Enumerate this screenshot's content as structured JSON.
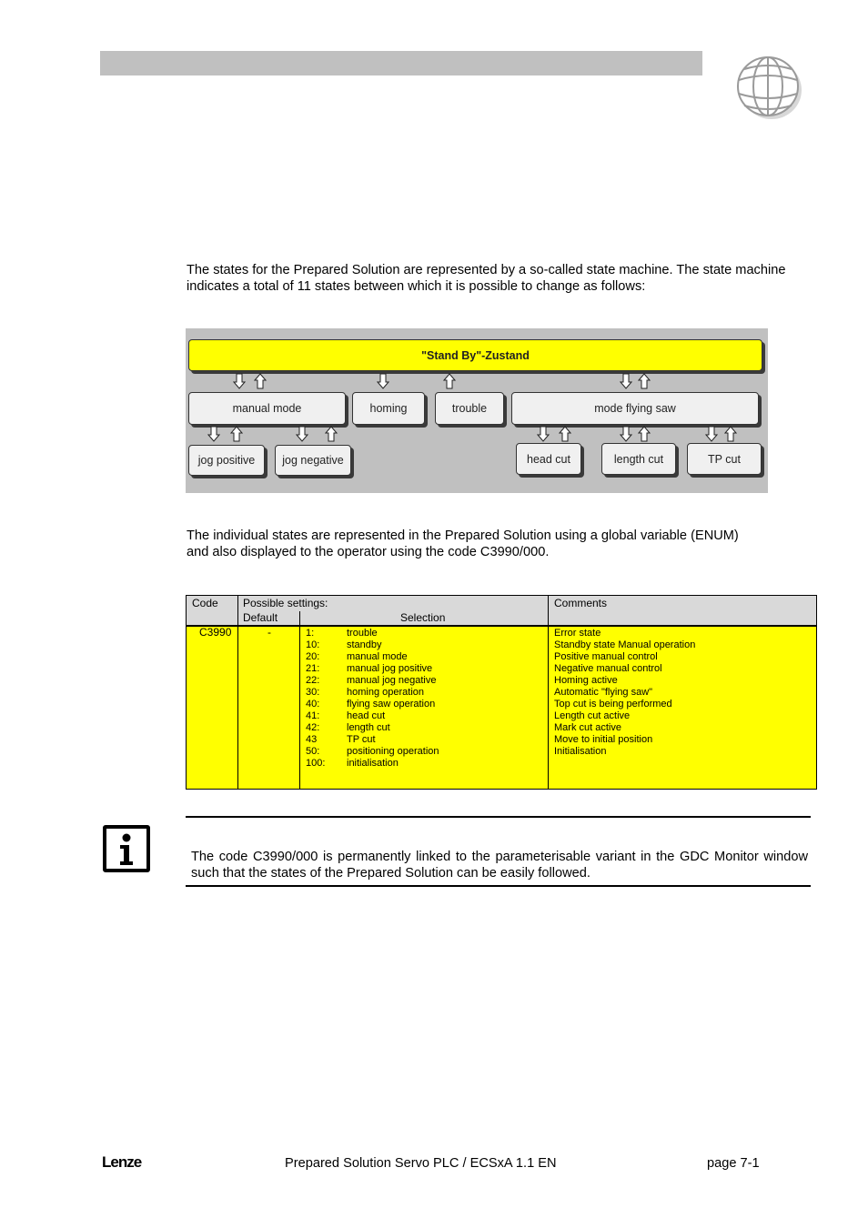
{
  "header": {
    "logo_icon": "globe-icon"
  },
  "intro_paragraph": "The states for the Prepared Solution are represented by a so-called state machine. The state machine indicates a total of 11 states between which it is possible to change as follows:",
  "diagram": {
    "standby": "\"Stand By\"-Zustand",
    "level1": [
      "manual mode",
      "homing",
      "trouble",
      "mode flying saw"
    ],
    "manual_children": [
      "jog positive",
      "jog negative"
    ],
    "flying_saw_children": [
      "head cut",
      "length cut",
      "TP cut"
    ],
    "colors": {
      "standby": "#ffff00",
      "background": "#c0c0c0",
      "box": "#f0f0f0"
    }
  },
  "enum_paragraph": "The individual states are represented in the Prepared Solution using a global variable (ENUM) and also displayed to the operator using the code C3990/000.",
  "table": {
    "headers": {
      "code": "Code",
      "possible_settings": "Possible settings:",
      "default": "Default",
      "selection": "Selection",
      "comments": "Comments"
    },
    "row": {
      "code": "C3990",
      "default": "-",
      "selection_values": [
        "1:",
        "10:",
        "20:",
        "21:",
        "22:",
        "30:",
        "40:",
        "41:",
        "42:",
        "43",
        "50:",
        "100:"
      ],
      "selection_labels": [
        "trouble",
        "standby",
        "manual mode",
        "manual jog positive",
        "manual jog negative",
        "homing operation",
        "flying saw operation",
        "head cut",
        "length cut",
        "TP cut",
        "positioning operation",
        "initialisation"
      ],
      "comments": [
        "Error state",
        "Standby state Manual operation",
        "Positive manual control",
        "Negative manual control",
        "Homing active",
        "Automatic \"flying saw\"",
        "Top cut is being performed",
        "Length cut active",
        "Mark cut active",
        "Move to initial position",
        "Initialisation"
      ]
    },
    "colors": {
      "header_bg": "#d9d9d9",
      "body_bg": "#ffff00"
    }
  },
  "note": {
    "icon": "info-icon",
    "text": "The code C3990/000 is permanently linked to the parameterisable variant in the GDC Monitor window such that the states of the Prepared Solution can be easily followed."
  },
  "footer": {
    "logo": "Lenze",
    "title": "Prepared Solution Servo PLC / ECSxA 1.1 EN",
    "page": "page 7-1"
  }
}
